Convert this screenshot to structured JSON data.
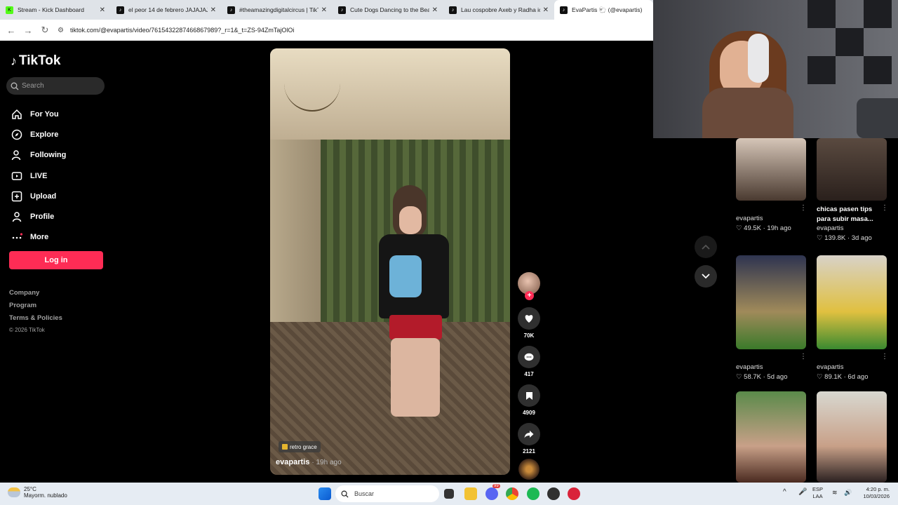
{
  "browser": {
    "tabs": [
      {
        "title": "Stream - Kick Dashboard",
        "favicon_color": "#53fc18",
        "close": "✕"
      },
      {
        "title": "el peor 14 de febrero JAJAJAJ",
        "favicon_color": "#111111",
        "close": "✕"
      },
      {
        "title": "#theamazingdigitalcircus | TikT",
        "favicon_color": "#111111",
        "close": "✕"
      },
      {
        "title": "Cute Dogs Dancing to the Beat",
        "favicon_color": "#111111",
        "close": "✕"
      },
      {
        "title": "Lau cospobre Axeb y Radha ic",
        "favicon_color": "#111111",
        "close": "✕"
      },
      {
        "title": "EvaPartis 🐑 (@evapartis)",
        "favicon_color": "#111111",
        "close": ""
      }
    ],
    "url": "tiktok.com/@evapartis/video/7615432287466867989?_r=1&_t=ZS-94ZmTajOlOi"
  },
  "sidebar": {
    "logo": "TikTok",
    "search_placeholder": "Search",
    "nav": [
      {
        "label": "For You",
        "icon": "home-icon"
      },
      {
        "label": "Explore",
        "icon": "compass-icon"
      },
      {
        "label": "Following",
        "icon": "following-icon"
      },
      {
        "label": "LIVE",
        "icon": "live-icon"
      },
      {
        "label": "Upload",
        "icon": "upload-icon"
      },
      {
        "label": "Profile",
        "icon": "profile-icon"
      },
      {
        "label": "More",
        "icon": "more-icon"
      }
    ],
    "login": "Log in",
    "links": [
      "Company",
      "Program",
      "Terms & Policies"
    ],
    "copyright": "© 2026 TikTok"
  },
  "video": {
    "song": "retro grace",
    "author": "evapartis",
    "time": "· 19h ago"
  },
  "actions": {
    "likes": "70K",
    "comments": "417",
    "saves": "4909",
    "shares": "2121"
  },
  "grid": [
    {
      "user": "evapartis",
      "stat": "♡ 49.5K · 19h ago",
      "title": ""
    },
    {
      "user": "evapartis",
      "stat": "♡ 139.8K · 3d ago",
      "title": "chicas pasen tips para subir masa..."
    },
    {
      "user": "evapartis",
      "stat": "♡ 58.7K · 5d ago",
      "title": ""
    },
    {
      "user": "evapartis",
      "stat": "♡ 89.1K · 6d ago",
      "title": ""
    }
  ],
  "taskbar": {
    "weather_temp": "25°C",
    "weather_desc": "Mayorm. nublado",
    "search": "Buscar",
    "lang": "ESP",
    "layout": "LAA",
    "time": "4:20 p. m.",
    "date": "10/03/2026",
    "badge": "99"
  },
  "colors": {
    "accent": "#fe2c55",
    "background": "#000000"
  }
}
